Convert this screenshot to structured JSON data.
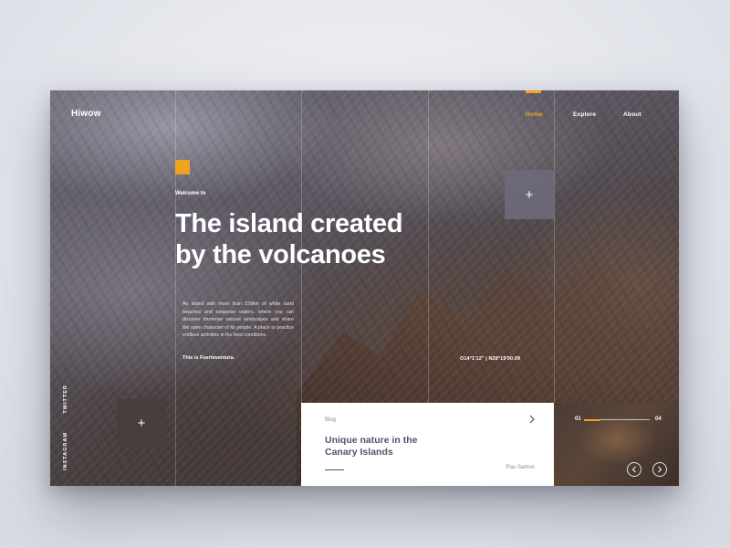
{
  "brand": {
    "logo": "Hiwow"
  },
  "nav": {
    "items": [
      {
        "label": "Home",
        "active": true
      },
      {
        "label": "Explore",
        "active": false
      },
      {
        "label": "About",
        "active": false
      }
    ]
  },
  "hero": {
    "welcome": "Welcome to",
    "title_line1": "The island created",
    "title_line2": "by the volcanoes",
    "description": "An island with more than 150km of white sand beaches and turquoise waters, where you can discover immense natural landscapes and share the open character of its people. A place to practice endless activities in the best conditions.",
    "tagline": "This is Fuerteventura.",
    "coordinates": "O14°1'12\"  |  N28°19'00.09"
  },
  "actions": {
    "plus_symbol": "+"
  },
  "social": {
    "links": [
      "INSTAGRAM",
      "TWITTER"
    ]
  },
  "blog": {
    "label": "Blog",
    "title": "Unique nature in the Canary Islands",
    "author": "Pau Samon",
    "arrow_icon": "chevron-right-icon"
  },
  "slider": {
    "current": "01",
    "total": "04",
    "progress": 0.25,
    "prev_icon": "chevron-left-icon",
    "next_icon": "chevron-right-icon"
  },
  "colors": {
    "accent": "#f0a224",
    "card_bg": "#ffffff",
    "title_text": "#58506a"
  }
}
